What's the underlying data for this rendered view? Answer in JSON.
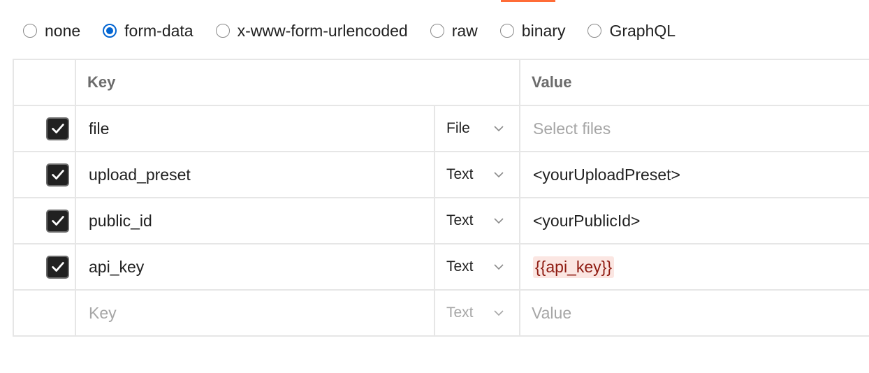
{
  "body_types": {
    "options": [
      {
        "label": "none",
        "checked": false
      },
      {
        "label": "form-data",
        "checked": true
      },
      {
        "label": "x-www-form-urlencoded",
        "checked": false
      },
      {
        "label": "raw",
        "checked": false
      },
      {
        "label": "binary",
        "checked": false
      },
      {
        "label": "GraphQL",
        "checked": false
      }
    ]
  },
  "table": {
    "headers": {
      "key": "Key",
      "value": "Value"
    },
    "rows": [
      {
        "checked": true,
        "key": "file",
        "type": "File",
        "value": "Select files",
        "value_is_placeholder": true
      },
      {
        "checked": true,
        "key": "upload_preset",
        "type": "Text",
        "value": "<yourUploadPreset>"
      },
      {
        "checked": true,
        "key": "public_id",
        "type": "Text",
        "value": "<yourPublicId>"
      },
      {
        "checked": true,
        "key": "api_key",
        "type": "Text",
        "value": "{{api_key}}",
        "value_is_variable": true
      }
    ],
    "new_row": {
      "key_placeholder": "Key",
      "type": "Text",
      "value_placeholder": "Value"
    }
  },
  "colors": {
    "accent": "#ff6c37",
    "radio_selected": "#0265d2",
    "variable_bg": "#fbe6e2",
    "variable_text": "#8e1a10"
  },
  "icons": {
    "checkbox": "check-icon",
    "dropdown": "chevron-down-icon"
  }
}
